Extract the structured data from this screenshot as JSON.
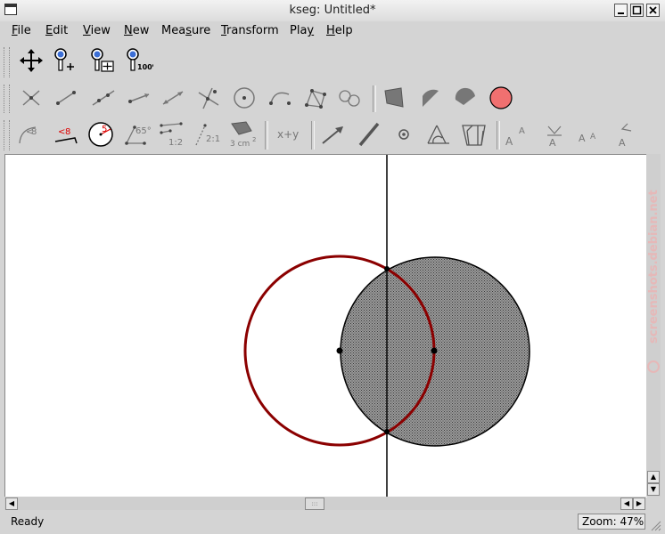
{
  "window": {
    "title": "kseg: Untitled*"
  },
  "menu": [
    {
      "pre": "",
      "ul": "F",
      "post": "ile"
    },
    {
      "pre": "",
      "ul": "E",
      "post": "dit"
    },
    {
      "pre": "",
      "ul": "V",
      "post": "iew"
    },
    {
      "pre": "",
      "ul": "N",
      "post": "ew"
    },
    {
      "pre": "Mea",
      "ul": "s",
      "post": "ure"
    },
    {
      "pre": "",
      "ul": "T",
      "post": "ransform"
    },
    {
      "pre": "Pla",
      "ul": "y",
      "post": ""
    },
    {
      "pre": "",
      "ul": "H",
      "post": "elp"
    }
  ],
  "toolbar3": {
    "angle_mark": "8",
    "length_mark": "8",
    "radius_mark": "5",
    "angle_value": "65°",
    "ratio": "1:2",
    "ratio2": "2:1",
    "area": "3 cm",
    "area_sup": "2",
    "calc": "x+y",
    "label_a": "A",
    "label_sup_a": "A"
  },
  "canvas": {
    "colors": {
      "construction": "#8b0000",
      "fill": "#777777",
      "line": "#000000"
    }
  },
  "watermark": "screenshots.debian.net",
  "status": {
    "text": "Ready",
    "zoom": "Zoom: 47%"
  }
}
